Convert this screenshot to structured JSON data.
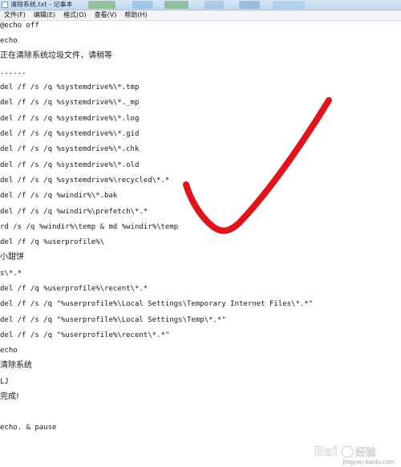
{
  "window": {
    "title": "清除系统.txt - 记事本"
  },
  "menu": [
    {
      "label": "文件(F)"
    },
    {
      "label": "编辑(E)"
    },
    {
      "label": "格式(O)"
    },
    {
      "label": "查看(V)"
    },
    {
      "label": "帮助(H)"
    }
  ],
  "editor": {
    "lines": [
      "@echo off",
      "echo",
      "正在清除系统垃圾文件，请稍等",
      "......",
      "del /f /s /q %systemdrive%\\*.tmp",
      "del /f /s /q %systemdrive%\\*._mp",
      "del /f /s /q %systemdrive%\\*.log",
      "del /f /s /q %systemdrive%\\*.gid",
      "del /f /s /q %systemdrive%\\*.chk",
      "del /f /s /q %systemdrive%\\*.old",
      "del /f /s /q %systemdrive%\\recycled\\*.*",
      "del /f /s /q %windir%\\*.bak",
      "del /f /s /q %windir%\\prefetch\\*.*",
      "rd /s /q %windir%\\temp & md %windir%\\temp",
      "del /f /q %userprofile%\\",
      "小甜饼",
      "s\\*.*",
      "del /f /q %userprofile%\\recent\\*.*",
      "del /f /s /q \"%userprofile%\\Local Settings\\Temporary Internet Files\\*.*\"",
      "del /f /s /q \"%userprofile%\\Local Settings\\Temp\\*.*\"",
      "del /f /s /q \"%userprofile%\\recent\\*.*\"",
      "echo",
      "清除系统",
      "LJ",
      "完成!",
      "",
      "echo. & pause"
    ]
  },
  "annotation": {
    "color": "#e0141b"
  },
  "watermark": {
    "text": "Bai 经验",
    "subtext": "jingyan.baidu.com"
  }
}
